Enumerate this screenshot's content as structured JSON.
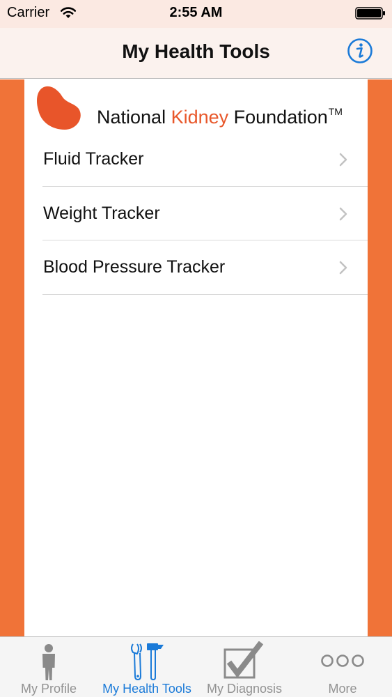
{
  "status_bar": {
    "carrier": "Carrier",
    "time": "2:55 AM"
  },
  "nav_bar": {
    "title": "My Health Tools"
  },
  "logo": {
    "text_before": "National ",
    "text_accent": "Kidney",
    "text_after": " Foundation",
    "trademark": "TM"
  },
  "tools": [
    {
      "label": "Fluid Tracker"
    },
    {
      "label": "Weight Tracker"
    },
    {
      "label": "Blood Pressure Tracker"
    }
  ],
  "tab_bar": {
    "tabs": [
      {
        "label": "My Profile"
      },
      {
        "label": "My Health Tools"
      },
      {
        "label": "My Diagnosis"
      },
      {
        "label": "More"
      }
    ]
  },
  "colors": {
    "accent": "#f07338",
    "brand_text": "#e8572a",
    "tint": "#1a7ad8",
    "inactive": "#929292"
  }
}
